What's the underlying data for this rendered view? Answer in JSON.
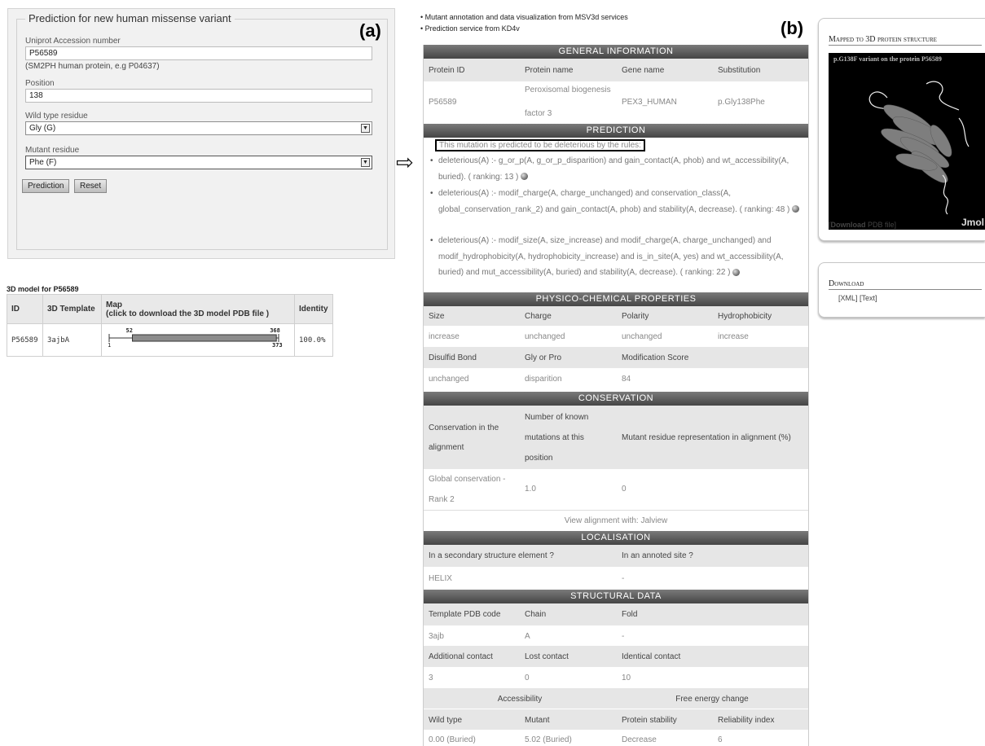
{
  "panel_labels": {
    "a": "(a)",
    "b": "(b)"
  },
  "form": {
    "title": "Prediction for new human missense variant",
    "uniprot_label": "Uniprot Accession number",
    "uniprot_value": "P56589",
    "uniprot_hint": "(SM2PH human protein, e.g P04637)",
    "position_label": "Position",
    "position_value": "138",
    "wild_label": "Wild type residue",
    "wild_value": "Gly (G)",
    "mutant_label": "Mutant residue",
    "mutant_value": "Phe (F)",
    "prediction_btn": "Prediction",
    "reset_btn": "Reset"
  },
  "model": {
    "title": "3D model for P56589",
    "headers": {
      "id": "ID",
      "template": "3D Template",
      "map_line1": "Map",
      "map_line2": "(click to download the 3D model PDB file )",
      "identity": "Identity"
    },
    "row": {
      "id": "P56589",
      "template": "3ajbA",
      "identity": "100.0%"
    },
    "map": {
      "start_label": "52",
      "end_label": "368",
      "min_label": "1",
      "max_label": "373",
      "start": 52,
      "end": 368,
      "min": 1,
      "max": 373
    }
  },
  "services": {
    "line1": "Mutant annotation and data visualization from MSV3d services",
    "line2": "Prediction service from KD4v"
  },
  "general": {
    "head": "GENERAL INFORMATION",
    "h_id": "Protein ID",
    "h_name": "Protein name",
    "h_gene": "Gene name",
    "h_sub": "Substitution",
    "v_id": "P56589",
    "v_name1": "Peroxisomal biogenesis",
    "v_name2": "factor 3",
    "v_gene": "PEX3_HUMAN",
    "v_sub": "p.Gly138Phe"
  },
  "prediction": {
    "head": "PREDICTION",
    "statement": "This mutation is predicted to be deleterious by the rules:",
    "rule1": "deleterious(A) :- g_or_p(A, g_or_p_disparition) and gain_contact(A, phob) and wt_accessibility(A, buried). ( ranking: 13 )",
    "rule2": "deleterious(A) :- modif_charge(A, charge_unchanged) and conservation_class(A, global_conservation_rank_2) and gain_contact(A, phob) and stability(A, decrease). ( ranking: 48 )",
    "rule3": "deleterious(A) :- modif_size(A, size_increase) and modif_charge(A, charge_unchanged) and modif_hydrophobicity(A, hydrophobicity_increase) and is_in_site(A, yes) and wt_accessibility(A, buried) and mut_accessibility(A, buried) and stability(A, decrease). ( ranking: 22 )"
  },
  "physico": {
    "head": "PHYSICO-CHEMICAL PROPERTIES",
    "h1": [
      "Size",
      "Charge",
      "Polarity",
      "Hydrophobicity"
    ],
    "v1": [
      "increase",
      "unchanged",
      "unchanged",
      "increase"
    ],
    "h2": [
      "Disulfid Bond",
      "Gly or Pro",
      "Modification Score"
    ],
    "v2": [
      "unchanged",
      "disparition",
      "84"
    ]
  },
  "conservation": {
    "head": "CONSERVATION",
    "h_cons1": "Conservation in the",
    "h_cons2": "alignment",
    "h_known1": "Number of known",
    "h_known2": "mutations at this",
    "h_known3": "position",
    "h_rep": "Mutant residue representation in alignment (%)",
    "v_cons1": "Global conservation -",
    "v_cons2": "Rank 2",
    "v_known": "1.0",
    "v_rep": "0",
    "jalview": "View alignment with: Jalview"
  },
  "localisation": {
    "head": "LOCALISATION",
    "h_sec": "In a secondary structure element ?",
    "h_site": "In an annoted site ?",
    "v_sec": "HELIX",
    "v_site": "-"
  },
  "structural": {
    "head": "STRUCTURAL DATA",
    "h1": [
      "Template PDB code",
      "Chain",
      "Fold"
    ],
    "v1": [
      "3ajb",
      "A",
      "-"
    ],
    "h2": [
      "Additional contact",
      "Lost contact",
      "Identical contact"
    ],
    "v2": [
      "3",
      "0",
      "10"
    ],
    "access": "Accessibility",
    "free_energy": "Free energy change",
    "h3": [
      "Wild type",
      "Mutant",
      "Protein stability",
      "Reliability index"
    ],
    "v3": [
      "0.00 (Buried)",
      "5.02 (Buried)",
      "Decrease",
      "6"
    ]
  },
  "sidebar": {
    "mapped_title": "Mapped to 3D protein structure",
    "jmol_caption": "p.G138F variant on the protein P56589",
    "jmol_brand": "Jmol",
    "download_pdb_open": "[",
    "download_pdb_bold": "Download",
    "download_pdb_rest": " PDB file]",
    "download_title": "Download",
    "download_links": "[XML] [Text]"
  },
  "icons": {
    "arrow": "right-double-arrow-icon",
    "select": "chevron-down-icon",
    "rank": "info-globe-icon"
  }
}
